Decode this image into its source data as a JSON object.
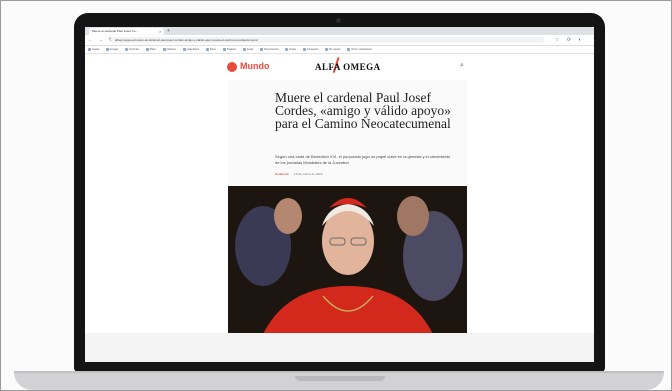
{
  "browser": {
    "tab_title": "Muere el cardenal Paul Josef Co...",
    "tab_close": "×",
    "new_tab": "+",
    "nav_icons": "← → ↻ ⌂",
    "url": "alfayomega.es/muere-el-cardenal-paul-josef-cordes-amigo-y-valido-apoyo-para-el-camino-neocatecumenal",
    "extension_icons": "☆ ⟳ ◐ ⋮",
    "bookmarks": [
      "Gmail",
      "Google",
      "YouTube",
      "Maps",
      "Noticias",
      "Calendario",
      "Drive",
      "Traducir",
      "Fotos",
      "Documentos",
      "Hojas",
      "Contactos",
      "Mi cuenta",
      "Otros marcadores"
    ]
  },
  "site": {
    "section": "Mundo",
    "brand": "ALFA OMEGA",
    "search_icon": "⌕"
  },
  "article": {
    "headline": "Muere el cardenal Paul Josef Cordes, «amigo y válido apoyo» para el Camino Neocatecumenal",
    "subheadline": "Según una carta de Benedicto XVI, el purpurado jugó un papel clave en la génesis y el crecimiento de los jornadas Mundiales de la Juventud",
    "author": "Redacción",
    "date": "15 de marzo de 2024"
  },
  "colors": {
    "accent": "#e84b3c",
    "cardinal_red": "#d3281c",
    "laptop_bezel": "#141414"
  }
}
